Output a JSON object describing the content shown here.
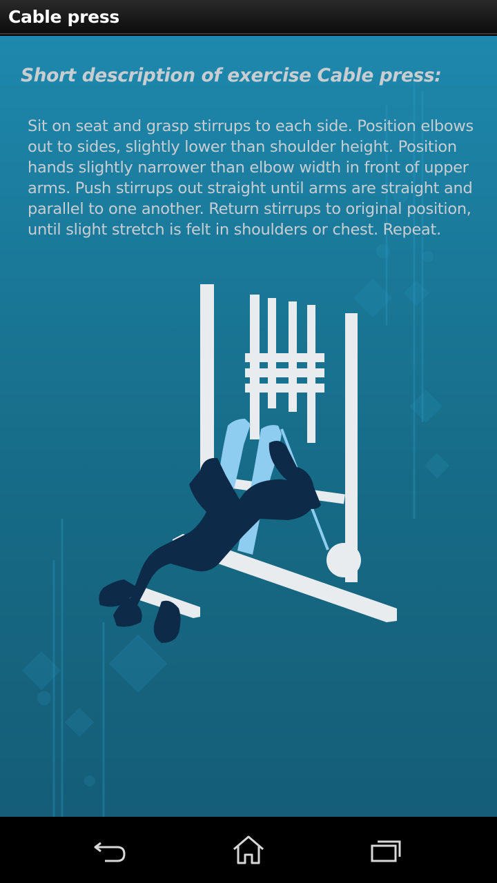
{
  "action_bar": {
    "title": "Cable press"
  },
  "content": {
    "heading": "Short description of exercise Cable press:",
    "description": "Sit on seat and grasp stirrups to each side. Position elbows out to sides, slightly lower than shoulder height. Position hands slightly narrower than elbow width in front of upper arms. Push stirrups out straight until arms are straight and parallel to one another. Return stirrups to original position, until slight stretch is felt in shoulders or chest. Repeat.",
    "illustration_icon": "cable-press-exercise-illustration"
  },
  "nav_bar": {
    "back_icon": "back-arrow-icon",
    "home_icon": "home-icon",
    "recent_icon": "recent-apps-icon"
  },
  "colors": {
    "action_bar": "#1a1a1a",
    "background_top": "#1e88ad",
    "background_bottom": "#155d78",
    "text": "#c7cdd1",
    "machine": "#e8ecef",
    "figure_dark": "#0d2a48",
    "arms_light": "#8ecdf0"
  }
}
